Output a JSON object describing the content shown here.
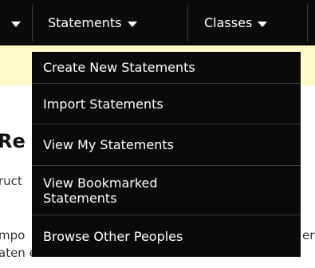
{
  "nav": {
    "tabs": [
      {
        "label": "",
        "icon": "chevron-down-icon"
      },
      {
        "label": "Statements",
        "icon": "chevron-down-icon"
      },
      {
        "label": "Classes",
        "icon": "chevron-down-icon"
      }
    ]
  },
  "background": {
    "heading": "Re",
    "line1": "ruct",
    "line2_left": "mpo",
    "line2_right": "er",
    "line3": "aten   ents can be created from scra"
  },
  "dropdown": {
    "items": [
      {
        "label": "Create New Statements"
      },
      {
        "label": "Import Statements"
      },
      {
        "label": "View My Statements"
      },
      {
        "label": "View Bookmarked Statements"
      },
      {
        "label": "Browse Other Peoples"
      }
    ]
  },
  "colors": {
    "nav_bg": "#0b0b0b",
    "highlight_strip": "#fff9c9",
    "menu_text": "#ffffff"
  }
}
